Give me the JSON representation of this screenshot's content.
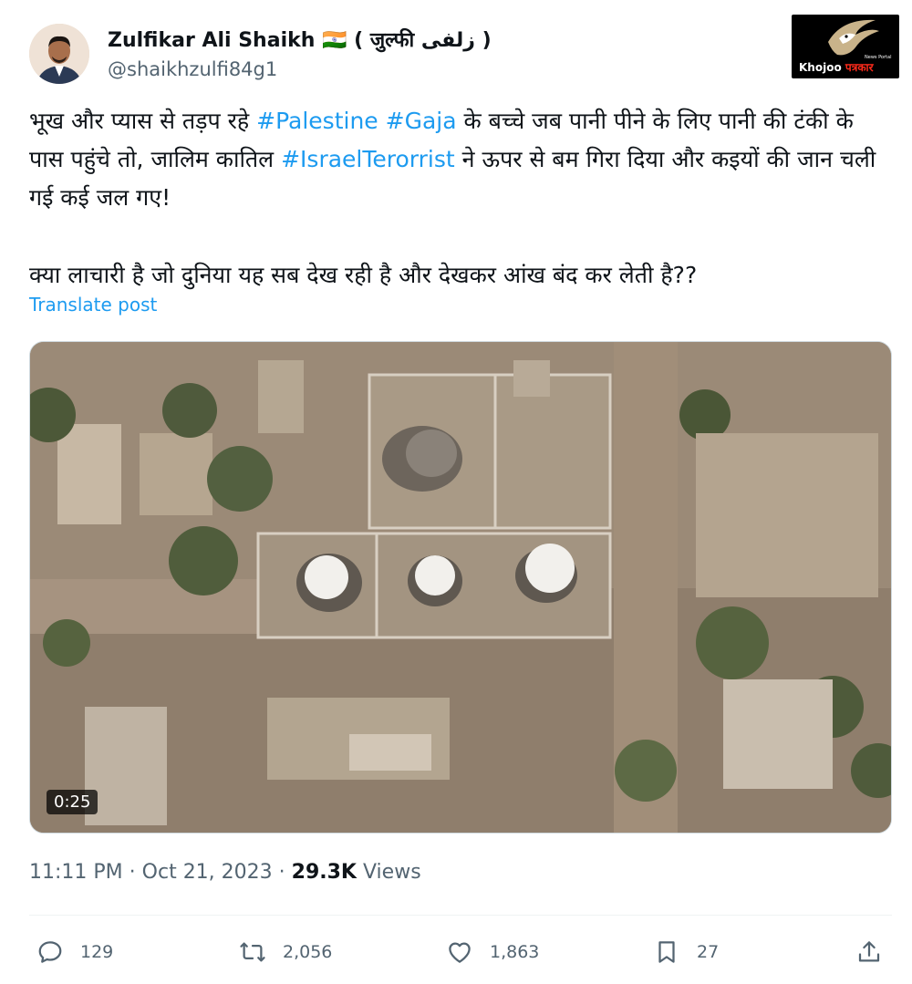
{
  "author": {
    "name": "Zulfikar Ali Shaikh 🇮🇳 ( जुल्फी زلفی )",
    "handle": "@shaikhzulfi84g1"
  },
  "watermark": {
    "brand": "Khojoo",
    "brand_hindi": "पत्रकार",
    "tagline": "News Portal"
  },
  "tweet": {
    "line1_pre": "भूख और प्यास से तड़प रहे ",
    "hashtag1": "#Palestine",
    "hashtag2": "#Gaja",
    "line1_post": " के बच्चे जब पानी पीने के लिए पानी की टंकी के पास पहुंचे तो, जालिम कातिल ",
    "hashtag3": "#IsraelTerorrist",
    "line1_end": " ने ऊपर से बम गिरा दिया और कइयों की जान चली गई कई जल गए!",
    "line2": "क्या लाचारी है जो दुनिया यह सब देख रही है और देखकर आंख बंद कर लेती है??",
    "translate": "Translate post"
  },
  "media": {
    "duration": "0:25"
  },
  "meta": {
    "time": "11:11 PM",
    "sep": "·",
    "date": "Oct 21, 2023",
    "views_count": "29.3K",
    "views_label": "Views"
  },
  "actions": {
    "replies": "129",
    "reposts": "2,056",
    "likes": "1,863",
    "bookmarks": "27"
  },
  "colors": {
    "accent": "#1d9bf0",
    "secondary_text": "#536471"
  }
}
